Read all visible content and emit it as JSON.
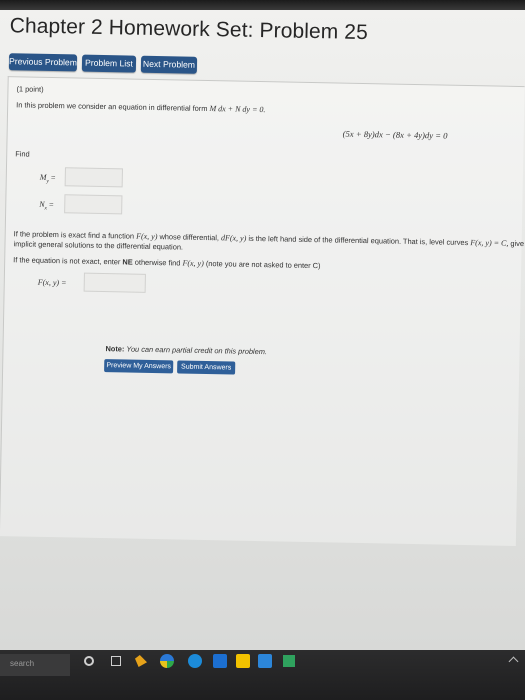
{
  "page": {
    "title": "Chapter 2 Homework Set: Problem 25",
    "nav": {
      "previous": "Previous Problem",
      "list": "Problem List",
      "next": "Next Problem"
    }
  },
  "problem": {
    "points": "(1 point)",
    "intro_text": "In this problem we consider an equation in differential form",
    "intro_math": "M dx + N dy = 0.",
    "equation": "(5x + 8y)dx − (8x + 4y)dy = 0",
    "find_label": "Find",
    "my_label": "M",
    "my_sub": "y",
    "nx_label": "N",
    "nx_sub": "x",
    "eq_sign": "=",
    "exact_a": "If the problem is exact find a function",
    "exact_f": "F(x, y)",
    "exact_b": "whose differential,",
    "exact_df": "dF(x, y)",
    "exact_c": "is the left hand side of the differential equation. That is, level curves",
    "exact_lc": "F(x, y) = C,",
    "exact_d": "give",
    "exact_line2": "implicit general solutions to the differential equation.",
    "ne_a": "If the equation is not exact, enter",
    "ne_b": "NE",
    "ne_c": "otherwise find",
    "ne_f": "F(x, y)",
    "ne_d": "(note you are not asked to enter C)",
    "fxy_label": "F(x, y) =",
    "note_bold": "Note:",
    "note_text": "You can earn partial credit on this problem.",
    "preview_button": "Preview My Answers",
    "submit_button": "Submit Answers"
  },
  "taskbar": {
    "search_text": "search"
  },
  "colors": {
    "nav_button": "#2a5588",
    "answer_box": "#ececea",
    "taskbar": "#222223"
  }
}
